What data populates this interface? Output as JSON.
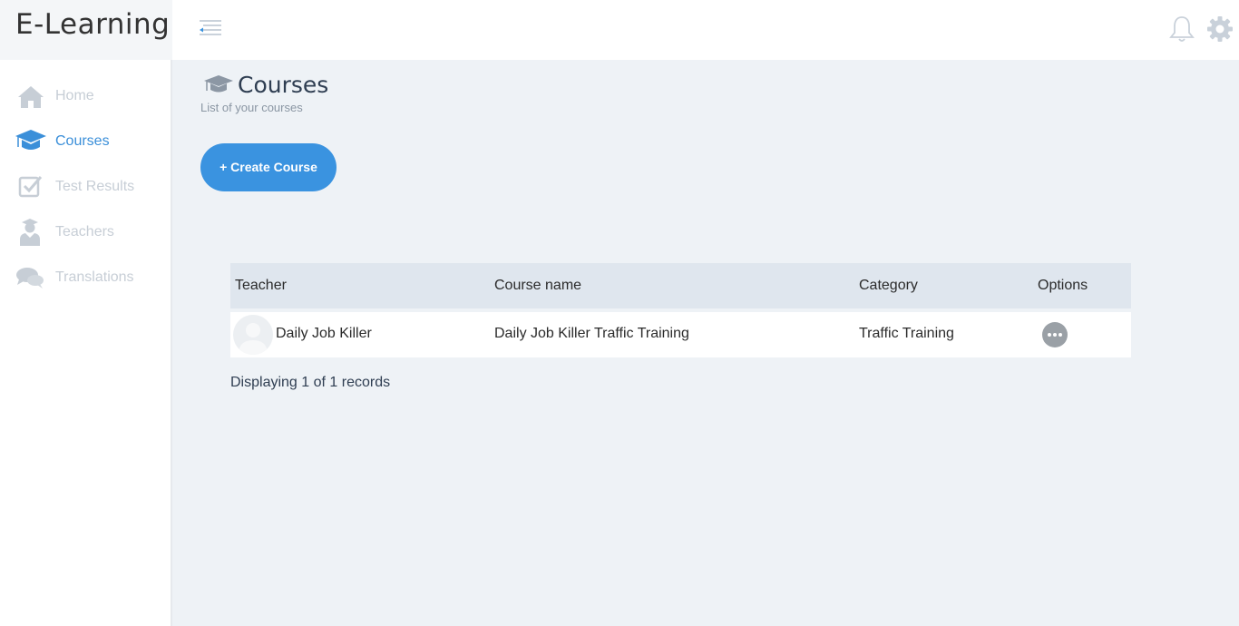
{
  "app": {
    "title": "E-Learning"
  },
  "header": {
    "menu_icon": "menu-collapse-icon",
    "bell_icon": "bell-icon",
    "gear_icon": "gear-icon"
  },
  "sidebar": {
    "items": [
      {
        "label": "Home",
        "icon": "home-icon",
        "active": false
      },
      {
        "label": "Courses",
        "icon": "graduation-cap-icon",
        "active": true
      },
      {
        "label": "Test Results",
        "icon": "checkbox-icon",
        "active": false
      },
      {
        "label": "Teachers",
        "icon": "teacher-icon",
        "active": false
      },
      {
        "label": "Translations",
        "icon": "chat-bubbles-icon",
        "active": false
      }
    ]
  },
  "main": {
    "title": "Courses",
    "subtitle": "List of your courses",
    "create_button": "+ Create Course",
    "table": {
      "columns": [
        "Teacher",
        "Course name",
        "Category",
        "Options"
      ],
      "rows": [
        {
          "teacher": "Daily Job Killer",
          "course_name": "Daily Job Killer Traffic Training",
          "category": "Traffic Training"
        }
      ]
    },
    "records_text": "Displaying 1 of 1 records"
  },
  "colors": {
    "accent": "#3a93e0",
    "sidebar_inactive": "#c7ced6",
    "background": "#eef2f6",
    "table_header": "#dfe6ee"
  }
}
